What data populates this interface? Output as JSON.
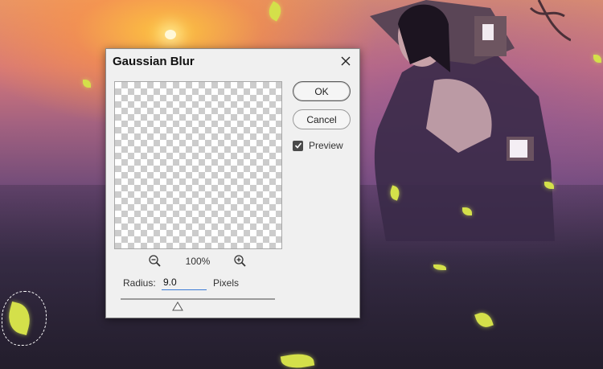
{
  "dialog": {
    "title": "Gaussian Blur",
    "ok_label": "OK",
    "cancel_label": "Cancel",
    "preview_label": "Preview",
    "preview_checked": true,
    "zoom_level": "100%",
    "radius_label": "Radius:",
    "radius_value": "9.0",
    "radius_unit": "Pixels",
    "slider_fraction": 0.37
  },
  "icons": {
    "close": "close-icon",
    "zoom_out": "zoom-out-icon",
    "zoom_in": "zoom-in-icon",
    "check": "checkmark-icon",
    "slider_thumb": "triangle-up-icon"
  },
  "colors": {
    "input_underline": "#3a7bd5",
    "dialog_bg": "#f0f0f0",
    "checkbox_bg": "#4a4a4a"
  }
}
